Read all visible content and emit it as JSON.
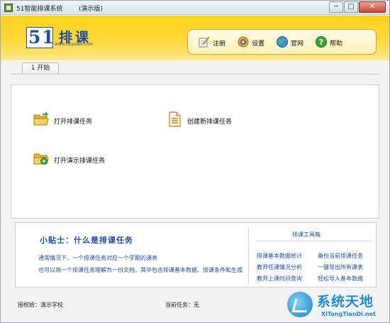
{
  "window": {
    "title": "51智能排课系统",
    "edition": "(演示版)",
    "minimize_symbol": "─",
    "maximize_symbol": "□",
    "close_symbol": "✕"
  },
  "brand": {
    "digit_five": "5",
    "digit_one": "1",
    "name": "排课",
    "url": "www.51paike.com",
    "color": "#1f4ea0"
  },
  "toolbar": {
    "items": [
      {
        "label": "注册",
        "icon": "register-pen-icon"
      },
      {
        "label": "设置",
        "icon": "settings-gear-icon"
      },
      {
        "label": "官网",
        "icon": "website-globe-icon"
      },
      {
        "label": "帮助",
        "icon": "help-question-icon"
      }
    ]
  },
  "tabs": [
    {
      "label": "1 开始",
      "active": true
    }
  ],
  "tasks": [
    {
      "label": "打开排课任务",
      "icon": "open-folder-icon"
    },
    {
      "label": "创建新排课任务",
      "icon": "new-document-icon"
    },
    {
      "label": "打开演示排课任务",
      "icon": "demo-folder-icon"
    }
  ],
  "tips": {
    "title": "小贴士：什么是排课任务",
    "line1": "通常情况下，一个排课任务对应一个学期的课表",
    "line2": "也可以将一个排课任务理解为一份文档，其中包含排课基本数据、排课条件和生成"
  },
  "tools": {
    "heading": "排课工具箱",
    "links": [
      "排课基本数据统计",
      "备份当前排课任务",
      "教师任课情况分析",
      "一键导出所有课表",
      "教师上课时间查询",
      "轻松导入基本数据"
    ]
  },
  "status": {
    "authorized": "授权给：演示学校",
    "current_task": "当前任务：无"
  },
  "watermark": {
    "cn": "系统天地",
    "en": "XiTongTianDi.net"
  },
  "colors": {
    "banner": "#ffd21f",
    "link": "#1f4ea0",
    "close_button": "#c9462f"
  }
}
